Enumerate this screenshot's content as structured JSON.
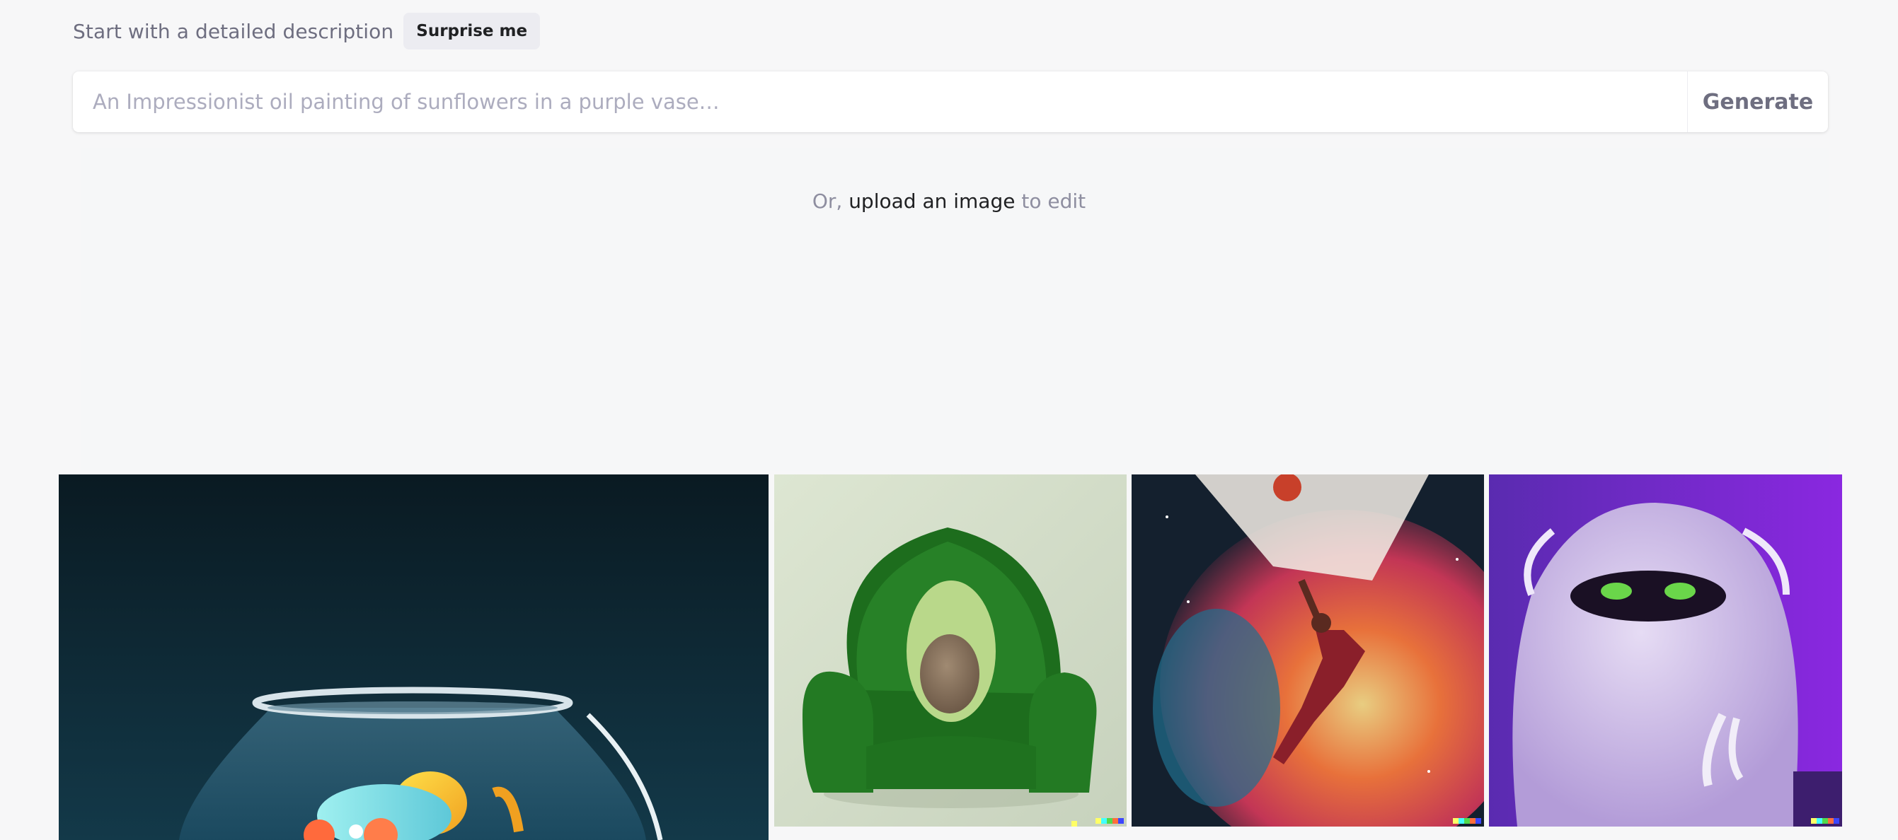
{
  "header": {
    "hint": "Start with a detailed description",
    "surprise_label": "Surprise me"
  },
  "prompt": {
    "placeholder": "An Impressionist oil painting of sunflowers in a purple vase…",
    "value": "",
    "generate_label": "Generate"
  },
  "upload": {
    "prefix": "Or,",
    "link": "upload an image",
    "suffix": "to edit"
  },
  "gallery": {
    "items": [
      {
        "icon": "fishbowl-image"
      },
      {
        "icon": "avocado-chair-image"
      },
      {
        "icon": "basketball-painting-image"
      },
      {
        "icon": "purple-monster-image"
      }
    ],
    "signature_colors": [
      "#ffff66",
      "#42ffff",
      "#51da4c",
      "#ff6e3c",
      "#3c46ff"
    ]
  },
  "colors": {
    "background": "#f7f7f8",
    "text_muted": "#6e6e80",
    "text_dark": "#202123"
  }
}
